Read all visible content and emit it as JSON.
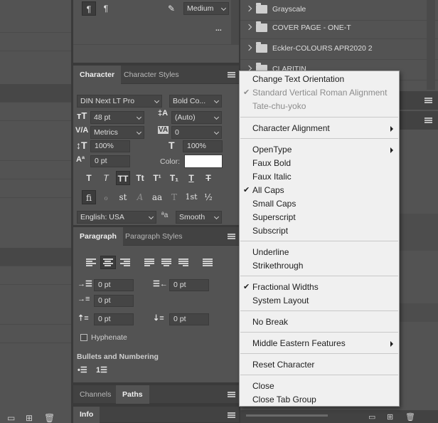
{
  "top": {
    "justify_value": "Medium",
    "more": "..."
  },
  "character": {
    "tabs": [
      "Character",
      "Character Styles"
    ],
    "font_family": "DIN Next LT Pro",
    "font_style": "Bold Co...",
    "size": "48 pt",
    "leading": "(Auto)",
    "kerning": "Metrics",
    "tracking": "0",
    "vscale": "100%",
    "hscale": "100%",
    "baseline": "0 pt",
    "color_label": "Color:",
    "style_buttons": [
      "T",
      "T",
      "TT",
      "Tt",
      "T¹",
      "T₁",
      "T",
      "T"
    ],
    "ot_buttons": [
      "fi",
      "ℴ",
      "st",
      "A",
      "aa",
      "T",
      "1st",
      "½"
    ],
    "language": "English: USA",
    "aa_glyph": "ªa",
    "antialias": "Smooth"
  },
  "paragraph": {
    "tabs": [
      "Paragraph",
      "Paragraph Styles"
    ],
    "indent_left": "0 pt",
    "indent_right": "0 pt",
    "indent_first": "0 pt",
    "space_before": "0 pt",
    "space_after": "0 pt",
    "hyphenate": "Hyphenate",
    "bullets_title": "Bullets and Numbering"
  },
  "bottom_tabs": [
    "Channels",
    "Paths"
  ],
  "info_tab": "Info",
  "layers": [
    "Grayscale",
    "COVER PAGE - ONE-T",
    "Eckler-COLOURS APR2020 2",
    "CLARITIN"
  ],
  "menu": {
    "items": [
      {
        "label": "Change Text Orientation",
        "checked": false,
        "disabled": false,
        "submenu": false
      },
      {
        "label": "Standard Vertical Roman Alignment",
        "checked": true,
        "disabled": true,
        "submenu": false
      },
      {
        "label": "Tate-chu-yoko",
        "checked": false,
        "disabled": true,
        "submenu": false
      },
      {
        "label": "Character Alignment",
        "checked": false,
        "disabled": false,
        "submenu": true
      },
      {
        "label": "OpenType",
        "checked": false,
        "disabled": false,
        "submenu": true
      },
      {
        "label": "Faux Bold",
        "checked": false,
        "disabled": false,
        "submenu": false
      },
      {
        "label": "Faux Italic",
        "checked": false,
        "disabled": false,
        "submenu": false
      },
      {
        "label": "All Caps",
        "checked": true,
        "disabled": false,
        "submenu": false
      },
      {
        "label": "Small Caps",
        "checked": false,
        "disabled": false,
        "submenu": false
      },
      {
        "label": "Superscript",
        "checked": false,
        "disabled": false,
        "submenu": false
      },
      {
        "label": "Subscript",
        "checked": false,
        "disabled": false,
        "submenu": false
      },
      {
        "label": "Underline",
        "checked": false,
        "disabled": false,
        "submenu": false
      },
      {
        "label": "Strikethrough",
        "checked": false,
        "disabled": false,
        "submenu": false
      },
      {
        "label": "Fractional Widths",
        "checked": true,
        "disabled": false,
        "submenu": false
      },
      {
        "label": "System Layout",
        "checked": false,
        "disabled": false,
        "submenu": false
      },
      {
        "label": "No Break",
        "checked": false,
        "disabled": false,
        "submenu": false
      },
      {
        "label": "Middle Eastern Features",
        "checked": false,
        "disabled": false,
        "submenu": true
      },
      {
        "label": "Reset Character",
        "checked": false,
        "disabled": false,
        "submenu": false
      },
      {
        "label": "Close",
        "checked": false,
        "disabled": false,
        "submenu": false
      },
      {
        "label": "Close Tab Group",
        "checked": false,
        "disabled": false,
        "submenu": false
      }
    ],
    "check_glyph": "✔"
  },
  "colors": {
    "panel": "#535353",
    "tabbar": "#424242",
    "menu_bg": "#f0f0f0",
    "text_color_swatch": "#ffffff"
  }
}
